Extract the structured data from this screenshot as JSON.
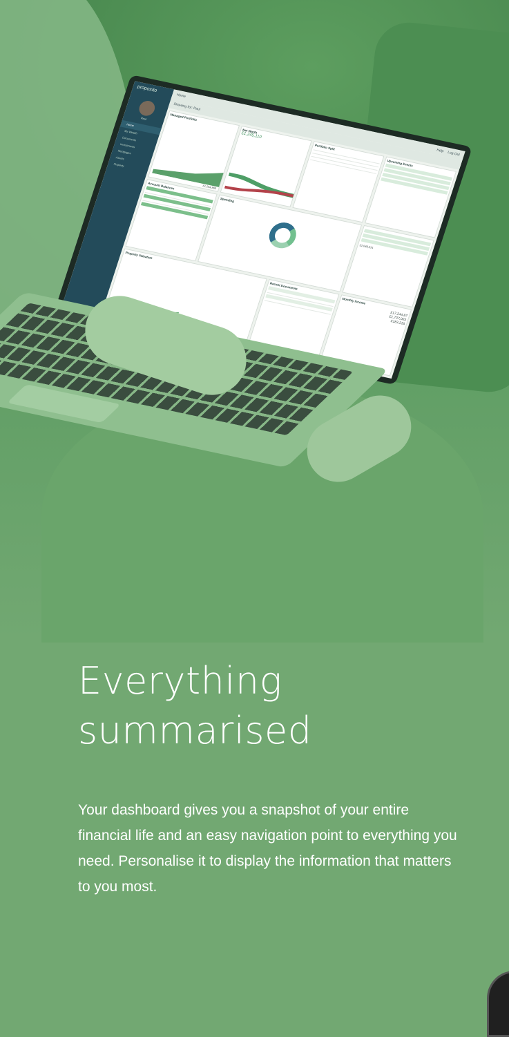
{
  "hero": {
    "laptop": {
      "app_logo": "proposito",
      "page_heading": "Home",
      "filter_label": "Showing for: Paul",
      "topbar_help": "Help",
      "topbar_logout": "Log Out",
      "user_name": "Paul",
      "nav": [
        "Home",
        "My Wealth",
        "Documents",
        "Investments",
        "Mortgages",
        "Assets",
        "Property"
      ],
      "widgets": [
        {
          "title": "Managed Portfolio",
          "value": "£1,244,860"
        },
        {
          "title": "Net Worth",
          "value": "£1,245,110"
        },
        {
          "title": "Portfolio Split",
          "value": ""
        },
        {
          "title": "Upcoming Events",
          "value": ""
        },
        {
          "title": "Account Balances",
          "value": ""
        },
        {
          "title": "Spending",
          "value": ""
        },
        {
          "title": "Recent Documents",
          "value": ""
        },
        {
          "title": "Monthly Income",
          "value": "£17,244.87"
        },
        {
          "title": "Property Valuation",
          "value": ""
        },
        {
          "title": "",
          "value": "£2,049,375"
        },
        {
          "title": "",
          "value": "£1,737,003"
        },
        {
          "title": "",
          "value": "£183,216"
        }
      ]
    }
  },
  "copy": {
    "headline_line1": "Everything",
    "headline_line2": "summarised",
    "body": "Your dashboard gives you a snapshot of your entire financial life and an easy navigation point to everything you need. Personalise it to display the information that matters to you most."
  },
  "colors": {
    "background": "#72a872",
    "text": "#ffffff",
    "sidebar": "#234b5a",
    "accent_green": "#7cbf8b"
  }
}
